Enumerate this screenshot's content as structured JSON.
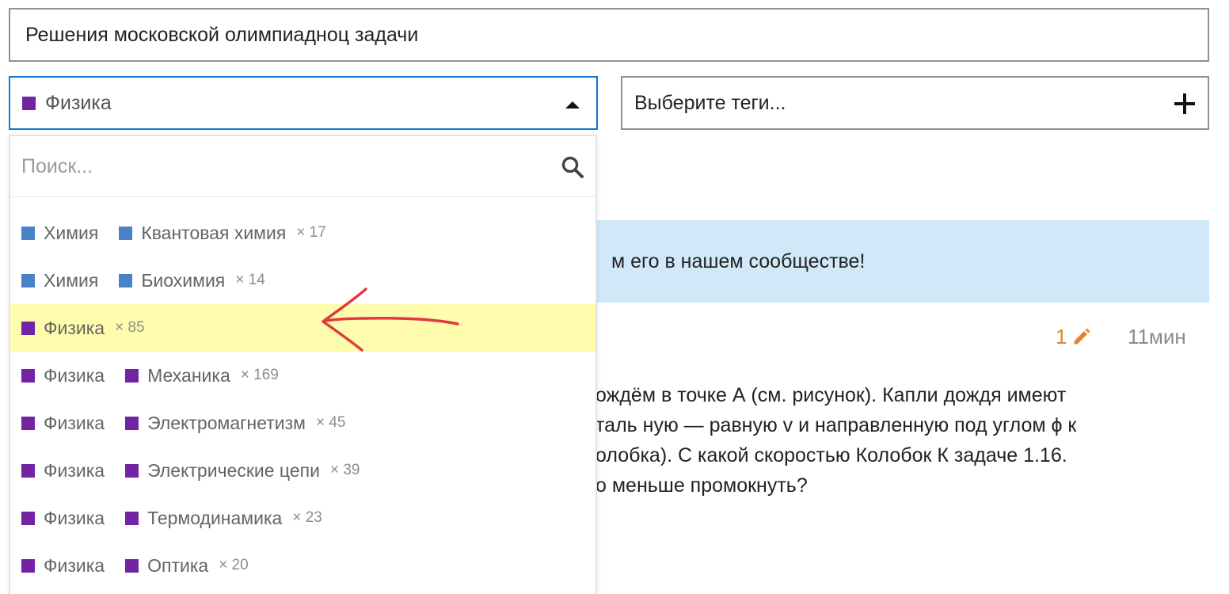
{
  "composer": {
    "title_value": "Решения московской олимпиадноц задачи",
    "category": {
      "name": "Физика",
      "color": "#7324a3"
    },
    "tags_placeholder": "Выберите теги..."
  },
  "dropdown": {
    "search_placeholder": "Поиск...",
    "options": [
      {
        "parent": "Химия",
        "parent_color": "#4a82c8",
        "child": "Квантовая химия",
        "child_color": "#4a82c8",
        "count": "× 17",
        "highlighted": false
      },
      {
        "parent": "Химия",
        "parent_color": "#4a82c8",
        "child": "Биохимия",
        "child_color": "#4a82c8",
        "count": "× 14",
        "highlighted": false
      },
      {
        "parent": "Физика",
        "parent_color": "#7324a3",
        "child": "",
        "child_color": "",
        "count": "× 85",
        "highlighted": true
      },
      {
        "parent": "Физика",
        "parent_color": "#7324a3",
        "child": "Механика",
        "child_color": "#7324a3",
        "count": "× 169",
        "highlighted": false
      },
      {
        "parent": "Физика",
        "parent_color": "#7324a3",
        "child": "Электромагнетизм",
        "child_color": "#7324a3",
        "count": "× 45",
        "highlighted": false
      },
      {
        "parent": "Физика",
        "parent_color": "#7324a3",
        "child": "Электрические цепи",
        "child_color": "#7324a3",
        "count": "× 39",
        "highlighted": false
      },
      {
        "parent": "Физика",
        "parent_color": "#7324a3",
        "child": "Термодинамика",
        "child_color": "#7324a3",
        "count": "× 23",
        "highlighted": false
      },
      {
        "parent": "Физика",
        "parent_color": "#7324a3",
        "child": "Оптика",
        "child_color": "#7324a3",
        "count": "× 20",
        "highlighted": false
      }
    ]
  },
  "background": {
    "banner_text": "м его в нашем сообществе!",
    "edit_count": "1",
    "age": "11мин",
    "post_lines": [
      "ождём в точке А (см. рисунок). Капли дождя имеют",
      "таль ную — равную v и направленную под углом ϕ к",
      "олобка). С какой скоростью Колобок К задаче 1.16.",
      "о меньше промокнуть?"
    ]
  },
  "colors": {
    "accent": "#0f79cf",
    "highlight": "#fffcad",
    "banner": "#d1e8f8",
    "edit": "#e5832c",
    "annotation_arrow": "#e0393e"
  }
}
